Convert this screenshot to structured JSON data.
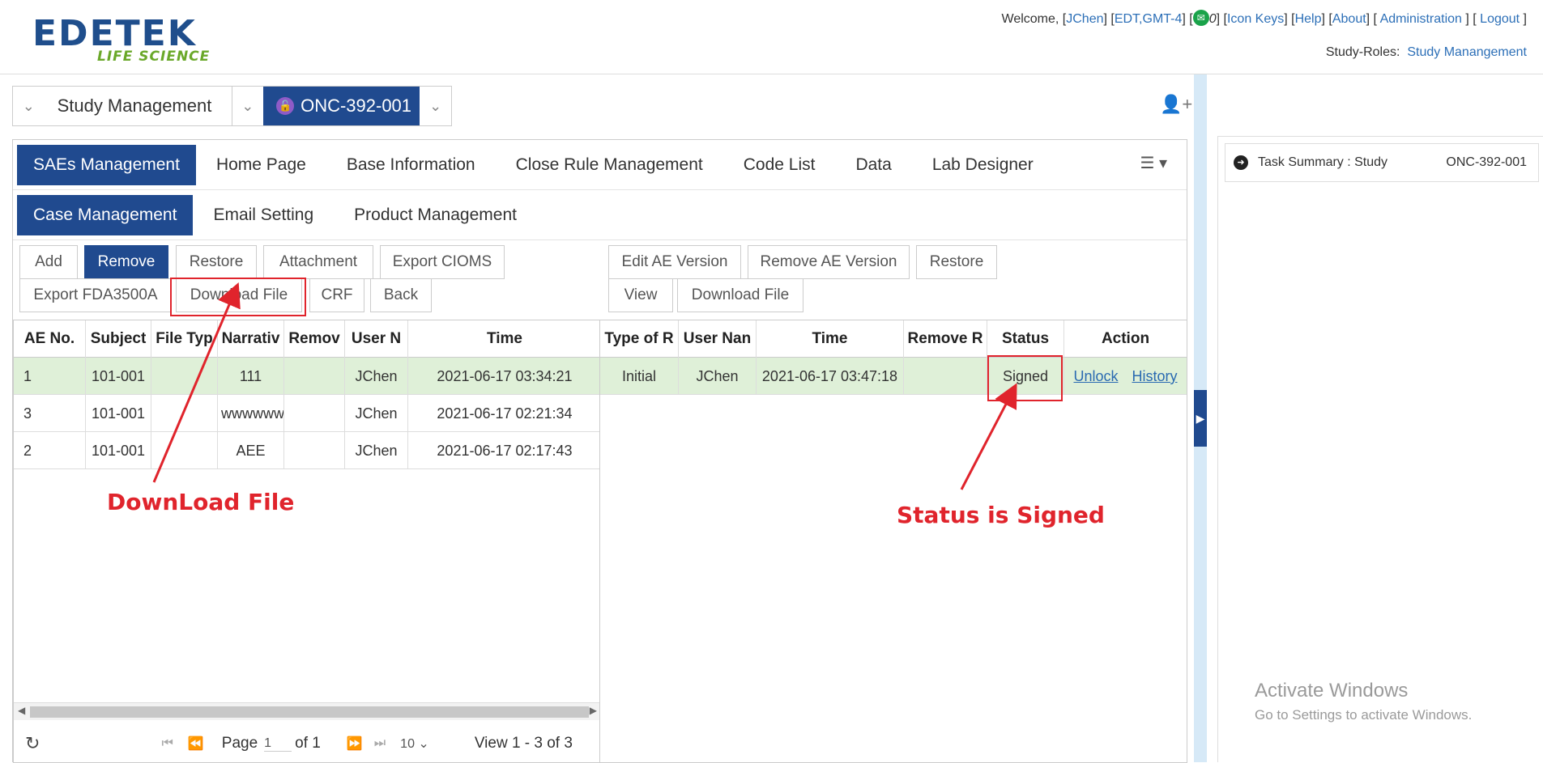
{
  "header": {
    "logo_main": "EDETEK",
    "logo_sub": "LIFE SCIENCE",
    "welcome": "Welcome, ",
    "user_link": "JChen",
    "tz_link": "EDT,GMT-4",
    "mail_count": "0",
    "icon_keys": "Icon Keys",
    "help": "Help",
    "about": "About",
    "administration": "Administration",
    "logout": "Logout",
    "roles_label": "Study-Roles:",
    "roles_value": "Study Manangement"
  },
  "studybar": {
    "study": "Study Management",
    "project": "ONC-392-001"
  },
  "nav": {
    "row1": [
      "SAEs Management",
      "Home Page",
      "Base Information",
      "Close Rule Management",
      "Code List",
      "Data",
      "Lab Designer"
    ],
    "row2": [
      "Case Management",
      "Email Setting",
      "Product Management"
    ]
  },
  "left_toolbar": {
    "row1": [
      "Add",
      "Remove",
      "Restore",
      "Attachment",
      "Export CIOMS"
    ],
    "row2": [
      "Export FDA3500A",
      "Download File",
      "CRF",
      "Back"
    ]
  },
  "right_toolbar": {
    "row1": [
      "Edit AE Version",
      "Remove AE Version",
      "Restore"
    ],
    "row2": [
      "View",
      "Download File"
    ]
  },
  "left_table": {
    "headers": [
      "AE No.",
      "Subject",
      "File Typ",
      "Narrativ",
      "Remov",
      "User N",
      "Time"
    ],
    "rows": [
      [
        "1",
        "101-001",
        "",
        "111",
        "",
        "JChen",
        "2021-06-17 03:34:21"
      ],
      [
        "3",
        "101-001",
        "",
        "wwwwww",
        "",
        "JChen",
        "2021-06-17 02:21:34"
      ],
      [
        "2",
        "101-001",
        "",
        "AEE",
        "",
        "JChen",
        "2021-06-17 02:17:43"
      ]
    ]
  },
  "right_table": {
    "headers": [
      "Type of R",
      "User Nan",
      "Time",
      "Remove R",
      "Status",
      "Action"
    ],
    "rows": [
      [
        "Initial",
        "JChen",
        "2021-06-17 03:47:18",
        "",
        "Signed"
      ]
    ],
    "actions": [
      "Unlock",
      "History"
    ]
  },
  "pager": {
    "page_label": "Page",
    "page_value": "1",
    "of_label": "of 1",
    "size": "10",
    "view": "View 1 - 3 of 3"
  },
  "right_panel": {
    "task_summary": "Task Summary : Study",
    "task_study": "ONC-392-001"
  },
  "watermark": {
    "line1": "Activate Windows",
    "line2": "Go to Settings to activate Windows."
  },
  "annotations": {
    "download": "DownLoad File",
    "status": "Status is Signed"
  },
  "colors": {
    "primary": "#204a8f",
    "selected_row": "#dff0d8",
    "annotation": "#e0242c"
  }
}
